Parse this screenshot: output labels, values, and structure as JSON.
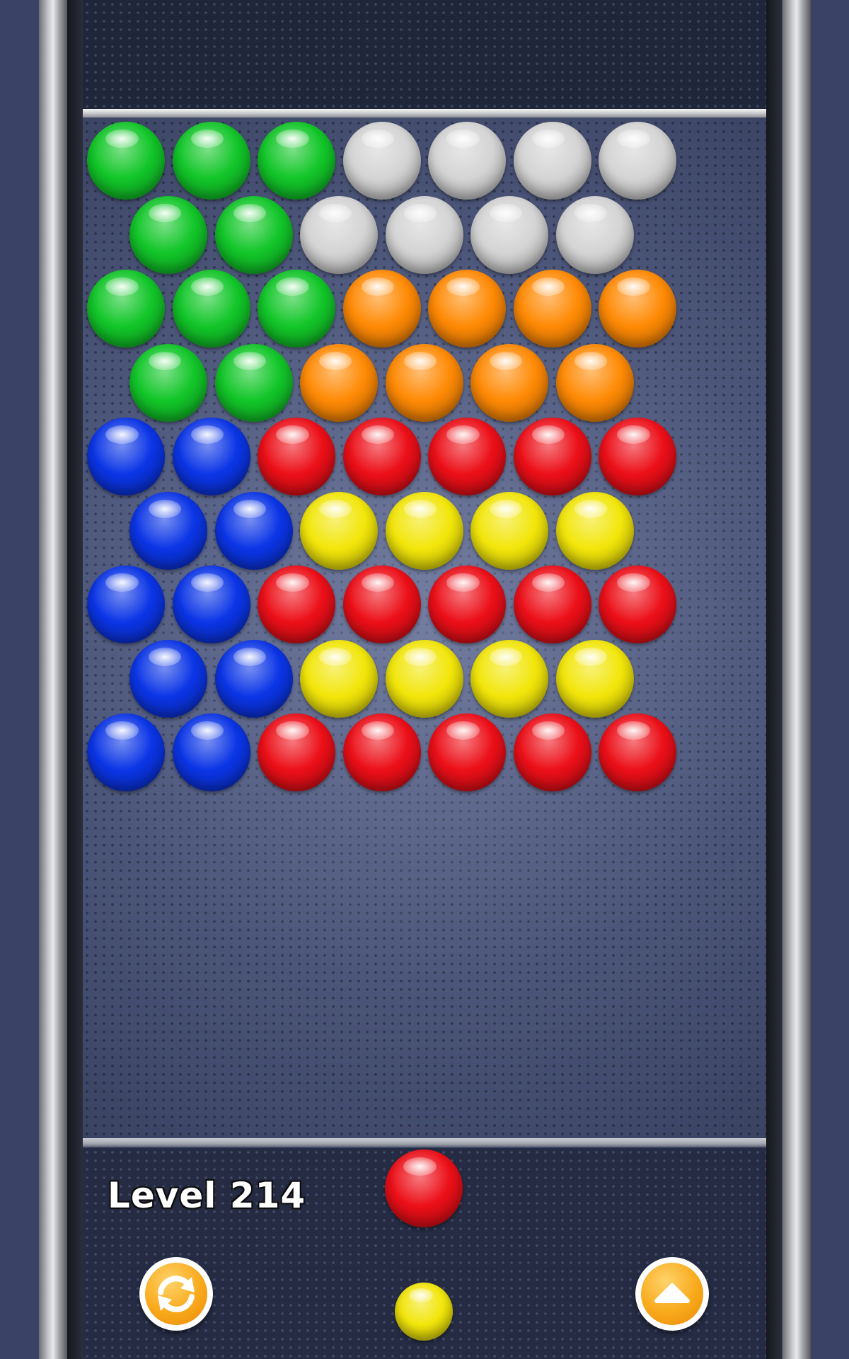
{
  "hud": {
    "level_label": "Level 214"
  },
  "buttons": {
    "swap_icon": "refresh-arrows-icon",
    "up_icon": "up-arrow-icon"
  },
  "colors": {
    "green": "#12c629",
    "white": "#d4d4d4",
    "orange": "#ff8a05",
    "blue": "#0b35e6",
    "red": "#ec0f18",
    "yellow": "#f2e60a",
    "button_orange": "#f8a91a"
  },
  "grid": {
    "rows": [
      [
        "green",
        "green",
        "green",
        "white",
        "white",
        "white",
        "white"
      ],
      [
        "green",
        "green",
        "white",
        "white",
        "white",
        "white"
      ],
      [
        "green",
        "green",
        "green",
        "orange",
        "orange",
        "orange",
        "orange"
      ],
      [
        "green",
        "green",
        "orange",
        "orange",
        "orange",
        "orange"
      ],
      [
        "blue",
        "blue",
        "red",
        "red",
        "red",
        "red",
        "red"
      ],
      [
        "blue",
        "blue",
        "yellow",
        "yellow",
        "yellow",
        "yellow"
      ],
      [
        "blue",
        "blue",
        "red",
        "red",
        "red",
        "red",
        "red"
      ],
      [
        "blue",
        "blue",
        "yellow",
        "yellow",
        "yellow",
        "yellow"
      ],
      [
        "blue",
        "blue",
        "red",
        "red",
        "red",
        "red",
        "red"
      ]
    ]
  },
  "shooter": {
    "current": "red",
    "next": "yellow"
  }
}
